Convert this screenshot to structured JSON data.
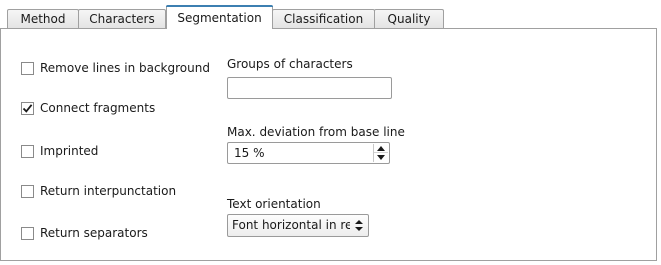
{
  "tabs": [
    {
      "label": "Method",
      "active": false
    },
    {
      "label": "Characters",
      "active": false
    },
    {
      "label": "Segmentation",
      "active": true
    },
    {
      "label": "Classification",
      "active": false
    },
    {
      "label": "Quality",
      "active": false
    }
  ],
  "checkboxes": [
    {
      "label": "Remove lines in background",
      "checked": false
    },
    {
      "label": "Connect fragments",
      "checked": true
    },
    {
      "label": "Imprinted",
      "checked": false
    },
    {
      "label": "Return interpunctation",
      "checked": false
    },
    {
      "label": "Return separators",
      "checked": false
    }
  ],
  "groups": {
    "label": "Groups of characters",
    "value": ""
  },
  "deviation": {
    "label": "Max. deviation from base line",
    "value": "15 %"
  },
  "orientation": {
    "label": "Text orientation",
    "value": "Font horizontal in re"
  },
  "icons": {
    "check": "checkmark-icon",
    "spin_up": "arrow-up-icon",
    "spin_down": "arrow-down-icon",
    "combo": "updown-arrows-icon"
  },
  "colors": {
    "active_tab_accent": "#3c7fb1",
    "border": "#a0a0a0"
  }
}
